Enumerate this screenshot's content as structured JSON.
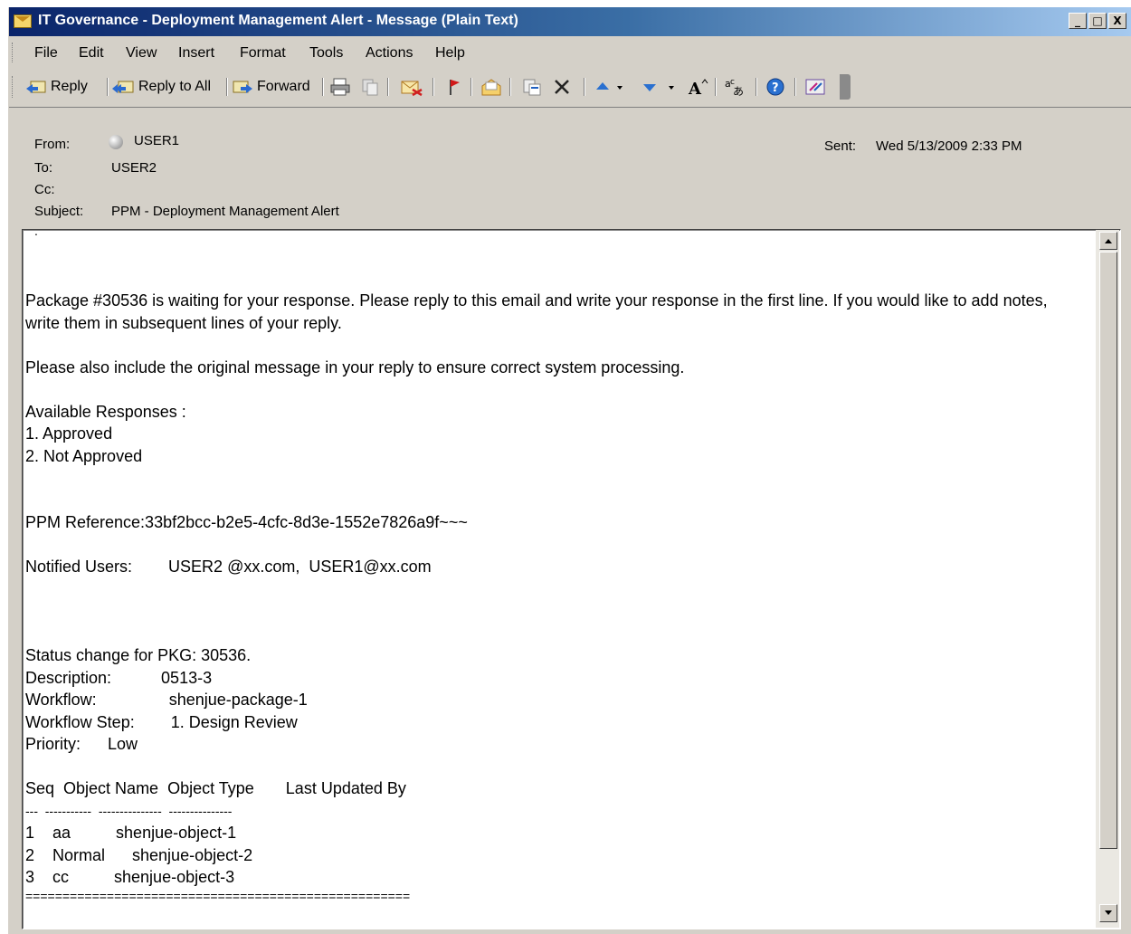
{
  "window": {
    "title": "IT Governance - Deployment Management Alert - Message (Plain Text)",
    "controls": [
      "_",
      "□",
      "X"
    ]
  },
  "menu": [
    "File",
    "Edit",
    "View",
    "Insert",
    "Format",
    "Tools",
    "Actions",
    "Help"
  ],
  "toolbar": {
    "reply": "Reply",
    "reply_all": "Reply to All",
    "forward": "Forward"
  },
  "header": {
    "from_label": "From:",
    "from_value": "USER1",
    "to_label": "To:",
    "to_value": "USER2",
    "cc_label": "Cc:",
    "cc_value": "",
    "subject_label": "Subject:",
    "subject_value": "PPM - Deployment Management Alert",
    "sent_label": "Sent:",
    "sent_value": "Wed 5/13/2009 2:33 PM"
  },
  "body": {
    "dot": ".",
    "para1": "Package #30536 is waiting for your response. Please reply to this email and write your response in the first line. If you would like to add notes, write them in subsequent lines of your reply.",
    "para2": "Please also include the original message in your reply to ensure correct system processing.",
    "responses_title": "Available Responses :",
    "response1": "1. Approved",
    "response2": "2. Not Approved",
    "reference": "PPM Reference:33bf2bcc-b2e5-4cfc-8d3e-1552e7826a9f~~~",
    "notified": "Notified Users:        USER2 @xx.com,  USER1@xx.com",
    "status_change": "Status change for PKG: 30536.",
    "description": "Description:           0513-3",
    "workflow": "Workflow:                shenjue-package-1",
    "workflow_step": "Workflow Step:        1. Design Review",
    "priority": "Priority:      Low",
    "table_header": "Seq  Object Name  Object Type       Last Updated By",
    "table_rule": "---  -----------  ---------------  ---------------",
    "row1": "1    aa          shenjue-object-1",
    "row2": "2    Normal      shenjue-object-2",
    "row3": "3    cc          shenjue-object-3",
    "footer_rule": "===================================================="
  }
}
